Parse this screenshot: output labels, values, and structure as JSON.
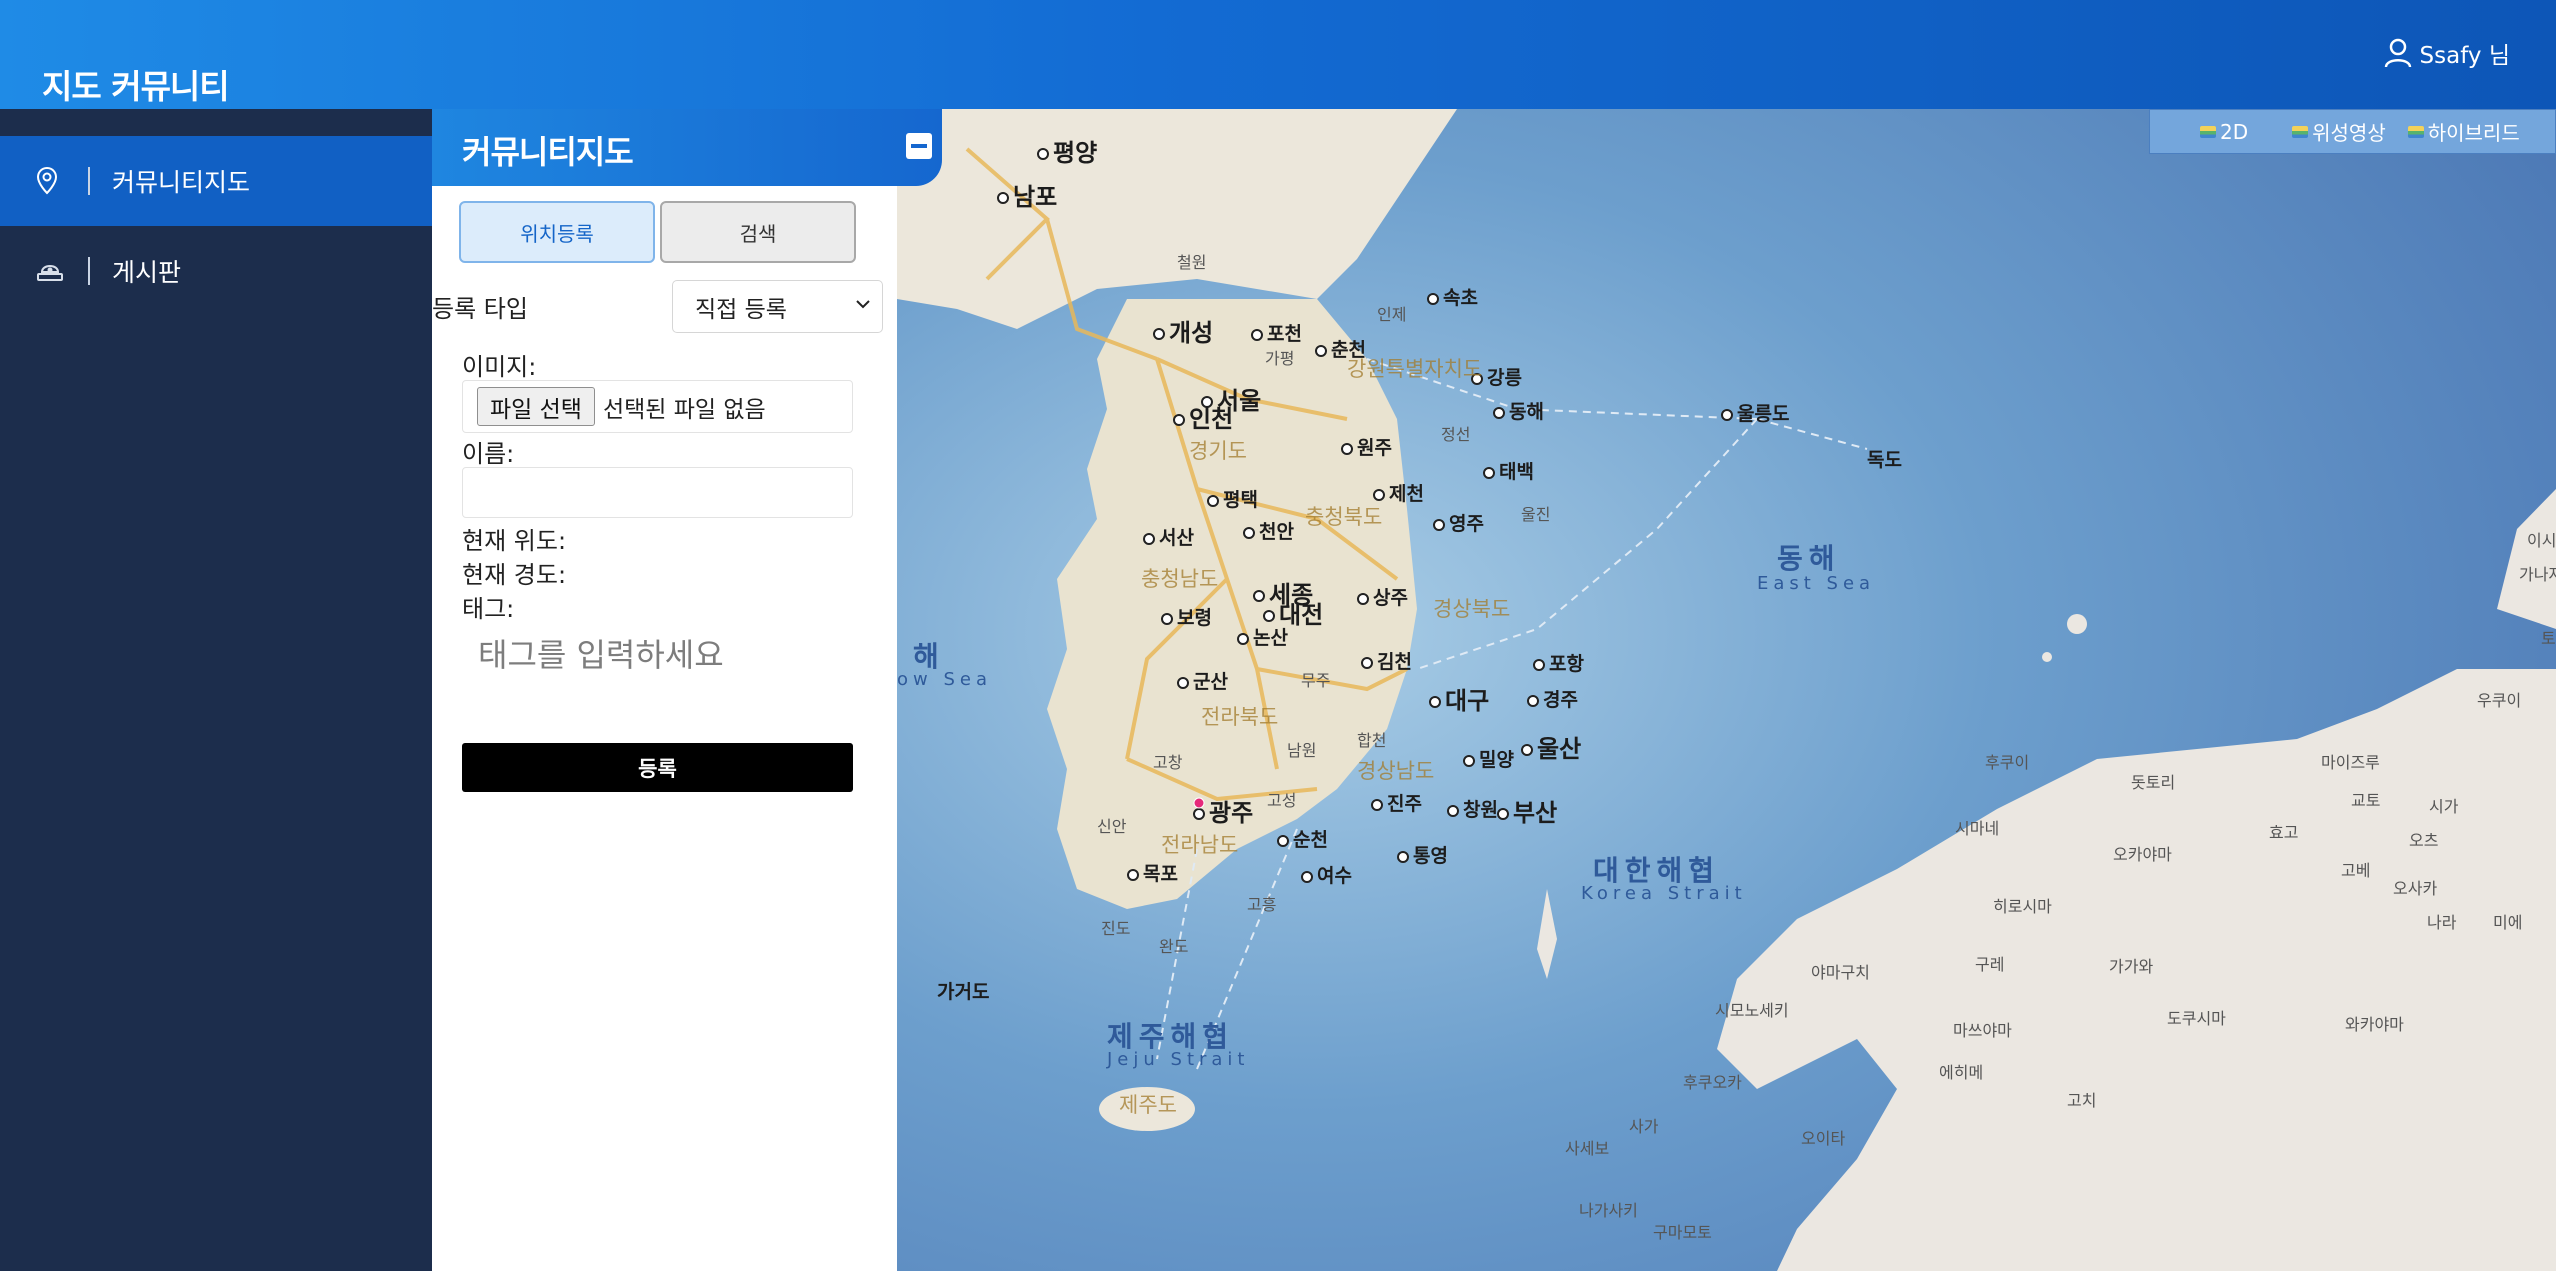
{
  "header": {
    "title": "지도 커뮤니티",
    "user_name": "Ssafy 님"
  },
  "sidebar": {
    "items": [
      {
        "label": "커뮤니티지도",
        "icon": "map-pin-icon",
        "active": true
      },
      {
        "label": "게시판",
        "icon": "board-icon",
        "active": false
      }
    ]
  },
  "panel": {
    "title": "커뮤니티지도",
    "tabs": {
      "register": "위치등록",
      "search": "검색"
    },
    "register_type_label": "등록 타입",
    "register_type_value": "직접 등록",
    "image_label": "이미지:",
    "file_button": "파일 선택",
    "file_status": "선택된 파일 없음",
    "name_label": "이름:",
    "lat_label": "현재 위도:",
    "lng_label": "현재 경도:",
    "tag_label": "태그:",
    "tag_placeholder": "태그를 입력하세요",
    "submit_label": "등록"
  },
  "map": {
    "layers": [
      "2D",
      "위성영상",
      "하이브리드"
    ],
    "cities_big": [
      "평양",
      "남포",
      "개성",
      "서울",
      "인천",
      "세종",
      "대전",
      "대구",
      "울산",
      "광주",
      "부산"
    ],
    "cities": [
      "속초",
      "춘천",
      "포천",
      "강릉",
      "동해",
      "원주",
      "태백",
      "제천",
      "평택",
      "서산",
      "천안",
      "영주",
      "상주",
      "보령",
      "논산",
      "김천",
      "군산",
      "포항",
      "경주",
      "밀양",
      "진주",
      "창원",
      "순천",
      "여수",
      "통영",
      "목포",
      "울릉도",
      "독도"
    ],
    "minor": [
      "철원",
      "가평",
      "인제",
      "정선",
      "울진",
      "무주",
      "합천",
      "고창",
      "고흥",
      "완도",
      "진도",
      "신안",
      "가거도",
      "남원",
      "고성"
    ],
    "provinces": [
      "강원특별자치도",
      "경기도",
      "충청북도",
      "충청남도",
      "경상북도",
      "전라북도",
      "경상남도",
      "전라남도",
      "제주도"
    ],
    "seas": [
      {
        "ko": "동해",
        "en": "East Sea"
      },
      {
        "ko": "대한해협",
        "en": "Korea Strait"
      },
      {
        "ko": "제주해협",
        "en": "Jeju Strait"
      },
      {
        "ko": "해",
        "en": "ow Sea"
      }
    ],
    "japan": [
      "후쿠이",
      "돗토리",
      "마이즈루",
      "교토",
      "시가",
      "시마네",
      "오카야마",
      "효고",
      "오츠",
      "고베",
      "오사카",
      "나라",
      "미에",
      "히로시마",
      "구레",
      "가가와",
      "야마구치",
      "시모노세키",
      "마쓰야마",
      "에히메",
      "도쿠시마",
      "와카야마",
      "후쿠오카",
      "오이타",
      "고치",
      "사가",
      "사세보",
      "나가사키",
      "구마모토",
      "우쿠이",
      "이시",
      "가나자",
      "토"
    ]
  }
}
